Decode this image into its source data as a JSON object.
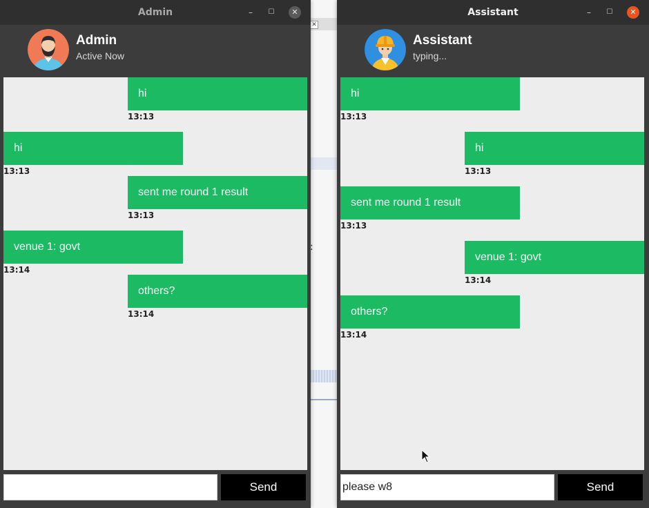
{
  "admin_window": {
    "title": "Admin",
    "header": {
      "name": "Admin",
      "status": "Active Now"
    },
    "messages": [
      {
        "side": "right",
        "text": "hi",
        "time": "13:13"
      },
      {
        "side": "left",
        "text": "hi",
        "time": "13:13"
      },
      {
        "side": "right",
        "text": "sent me round 1 result",
        "time": "13:13"
      },
      {
        "side": "left",
        "text": "venue 1: govt",
        "time": "13:14"
      },
      {
        "side": "right",
        "text": "others?",
        "time": "13:14"
      }
    ],
    "input": {
      "value": ""
    },
    "send_label": "Send"
  },
  "assistant_window": {
    "title": "Assistant",
    "header": {
      "name": "Assistant",
      "status": "typing..."
    },
    "messages": [
      {
        "side": "left",
        "text": "hi",
        "time": "13:13"
      },
      {
        "side": "right",
        "text": "hi",
        "time": "13:13"
      },
      {
        "side": "left",
        "text": "sent me round 1 result",
        "time": "13:13"
      },
      {
        "side": "right",
        "text": "venue 1: govt",
        "time": "13:14"
      },
      {
        "side": "left",
        "text": "others?",
        "time": "13:14"
      }
    ],
    "input": {
      "value": "please w8"
    },
    "send_label": "Send"
  },
  "titlebar_buttons": {
    "minimize": "–",
    "maximize": "☐",
    "close": "✕"
  },
  "background_window": {
    "close_glyph": "✕",
    "colon": ":"
  },
  "colors": {
    "bubble": "#1dba64",
    "chat_bg": "#ededed",
    "frame": "#3c3c3c",
    "send_button": "#000000",
    "close_active": "#e95420"
  }
}
